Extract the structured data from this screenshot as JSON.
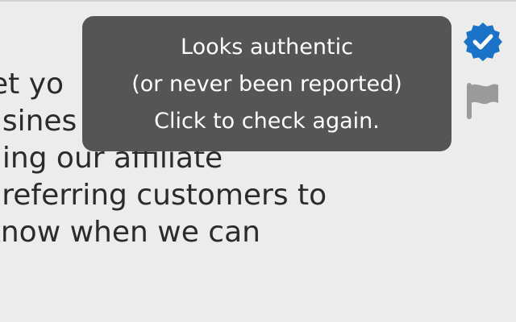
{
  "email_body": {
    "lines": [
      "let yo",
      "usines",
      "hing our affiliate",
      "r referring customers to",
      "know when we can"
    ]
  },
  "tooltip": {
    "line1": "Looks authentic",
    "line2": "(or never been reported)",
    "line3": "Click to check again."
  },
  "icons": {
    "verified": "verified-check-badge-icon",
    "report": "flag-icon"
  },
  "colors": {
    "background": "#ececec",
    "tooltip_bg": "#555555",
    "verified_blue": "#1a73c8",
    "flag_gray": "#9a9a9a"
  }
}
